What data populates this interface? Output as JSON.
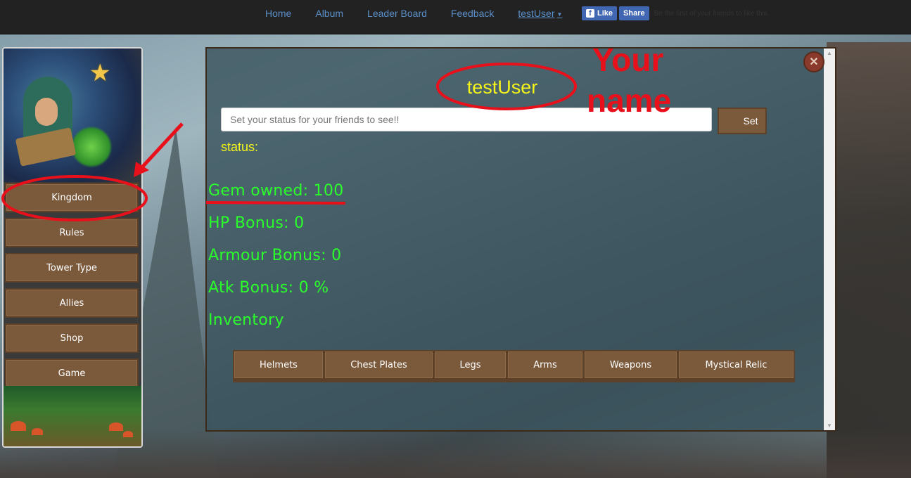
{
  "nav": {
    "links": [
      "Home",
      "Album",
      "Leader Board",
      "Feedback"
    ],
    "user": "testUser",
    "caret_icon": "caret-down-icon"
  },
  "facebook": {
    "like_label": "Like",
    "share_label": "Share",
    "social_text": "Be the first of your friends to like this."
  },
  "sidebar": {
    "items": [
      "Kingdom",
      "Rules",
      "Tower Type",
      "Allies",
      "Shop",
      "Game"
    ]
  },
  "profile": {
    "username": "testUser",
    "status_placeholder": "Set your status for your friends to see!!",
    "set_label": "Set",
    "status_label": "status:",
    "close_icon": "close-icon",
    "stats": {
      "gem": "Gem owned: 100",
      "hp": "HP Bonus: 0",
      "armour": "Armour Bonus: 0",
      "atk": "Atk Bonus: 0 %",
      "inventory": "Inventory"
    },
    "inventory_tabs": [
      "Helmets",
      "Chest Plates",
      "Legs",
      "Arms",
      "Weapons",
      "Mystical Relic"
    ]
  },
  "annotations": {
    "line1": "Your",
    "line2": "name",
    "color": "#e8101a"
  }
}
